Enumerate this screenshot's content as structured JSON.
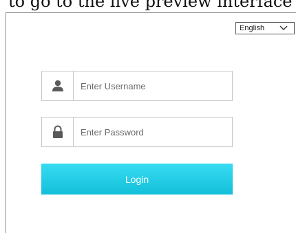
{
  "caption": "to go to the live preview interface",
  "language": {
    "selected": "English"
  },
  "username": {
    "placeholder": "Enter Username",
    "value": ""
  },
  "password": {
    "placeholder": "Enter Password",
    "value": ""
  },
  "login_button": {
    "label": "Login"
  },
  "icons": {
    "user": "user-icon",
    "lock": "lock-icon",
    "dropdown": "chevron-down-icon"
  },
  "colors": {
    "login_button": "#1fcbe3",
    "icon": "#5a5a5a",
    "field_border": "#c8c8c8"
  }
}
